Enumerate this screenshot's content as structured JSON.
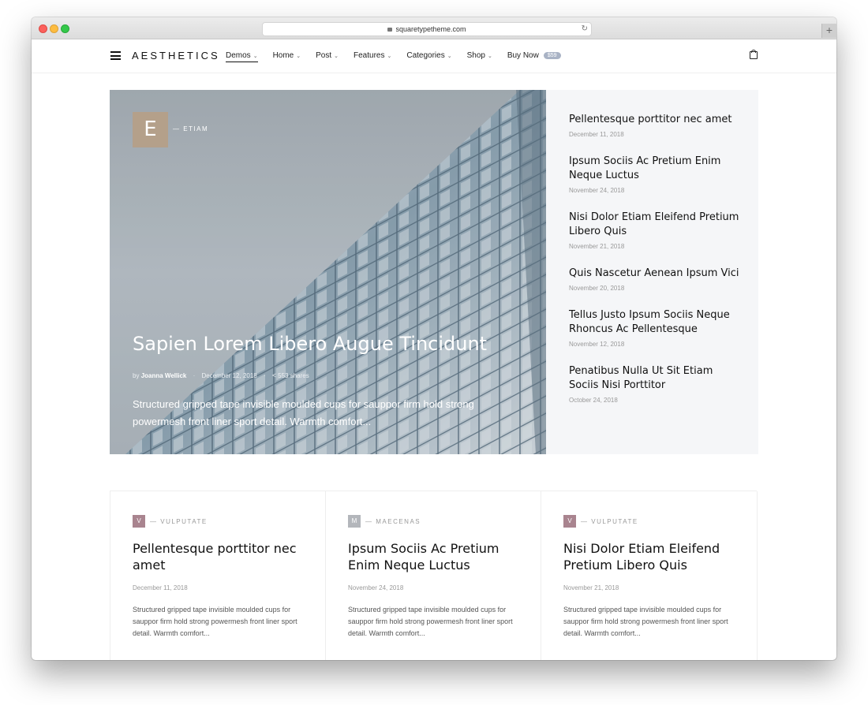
{
  "browser": {
    "url": "squaretypetheme.com",
    "new_tab_label": "+"
  },
  "nav": {
    "brand": "AESTHETICS",
    "menu": [
      {
        "label": "Demos",
        "chevron": true,
        "active": true
      },
      {
        "label": "Home",
        "chevron": true
      },
      {
        "label": "Post",
        "chevron": true
      },
      {
        "label": "Features",
        "chevron": true
      },
      {
        "label": "Categories",
        "chevron": true
      },
      {
        "label": "Shop",
        "chevron": true
      }
    ],
    "buy_now": {
      "label": "Buy Now",
      "price": "$59"
    }
  },
  "hero": {
    "category_letter": "E",
    "category": "ETIAM",
    "title": "Sapien Lorem Libero Augue Tincidunt",
    "by_label": "by",
    "author": "Joanna Wellick",
    "date": "December 12, 2018",
    "shares": "553 shares",
    "excerpt": "Structured gripped tape invisible moulded cups for sauppor firm hold strong powermesh front liner sport detail. Warmth comfort..."
  },
  "sidebar": {
    "posts": [
      {
        "title": "Pellentesque porttitor nec amet",
        "date": "December 11, 2018"
      },
      {
        "title": "Ipsum Sociis Ac Pretium Enim Neque Luctus",
        "date": "November 24, 2018"
      },
      {
        "title": "Nisi Dolor Etiam Eleifend Pretium Libero Quis",
        "date": "November 21, 2018"
      },
      {
        "title": "Quis Nascetur Aenean Ipsum Vici",
        "date": "November 20, 2018"
      },
      {
        "title": "Tellus Justo Ipsum Sociis Neque Rhoncus Ac Pellentesque",
        "date": "November 12, 2018"
      },
      {
        "title": "Penatibus Nulla Ut Sit Etiam Sociis Nisi Porttitor",
        "date": "October 24, 2018"
      }
    ]
  },
  "cards": [
    {
      "letter": "V",
      "color": "#a9848f",
      "category": "VULPUTATE",
      "title": "Pellentesque porttitor nec amet",
      "date": "December 11, 2018",
      "excerpt": "Structured gripped tape invisible moulded cups for sauppor firm hold strong powermesh front liner sport detail. Warmth comfort..."
    },
    {
      "letter": "M",
      "color": "#b3b6bb",
      "category": "MAECENAS",
      "title": "Ipsum Sociis Ac Pretium Enim Neque Luctus",
      "date": "November 24, 2018",
      "excerpt": "Structured gripped tape invisible moulded cups for sauppor firm hold strong powermesh front liner sport detail. Warmth comfort..."
    },
    {
      "letter": "V",
      "color": "#a9848f",
      "category": "VULPUTATE",
      "title": "Nisi Dolor Etiam Eleifend Pretium Libero Quis",
      "date": "November 21, 2018",
      "excerpt": "Structured gripped tape invisible moulded cups for sauppor firm hold strong powermesh front liner sport detail. Warmth comfort..."
    }
  ]
}
